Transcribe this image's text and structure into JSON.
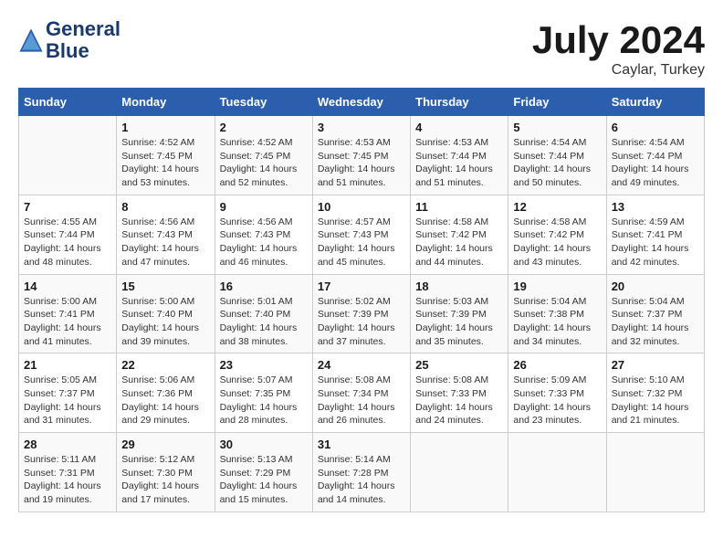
{
  "header": {
    "logo_line1": "General",
    "logo_line2": "Blue",
    "month": "July 2024",
    "location": "Caylar, Turkey"
  },
  "calendar": {
    "days_of_week": [
      "Sunday",
      "Monday",
      "Tuesday",
      "Wednesday",
      "Thursday",
      "Friday",
      "Saturday"
    ],
    "weeks": [
      [
        {
          "day": "",
          "info": ""
        },
        {
          "day": "1",
          "info": "Sunrise: 4:52 AM\nSunset: 7:45 PM\nDaylight: 14 hours\nand 53 minutes."
        },
        {
          "day": "2",
          "info": "Sunrise: 4:52 AM\nSunset: 7:45 PM\nDaylight: 14 hours\nand 52 minutes."
        },
        {
          "day": "3",
          "info": "Sunrise: 4:53 AM\nSunset: 7:45 PM\nDaylight: 14 hours\nand 51 minutes."
        },
        {
          "day": "4",
          "info": "Sunrise: 4:53 AM\nSunset: 7:44 PM\nDaylight: 14 hours\nand 51 minutes."
        },
        {
          "day": "5",
          "info": "Sunrise: 4:54 AM\nSunset: 7:44 PM\nDaylight: 14 hours\nand 50 minutes."
        },
        {
          "day": "6",
          "info": "Sunrise: 4:54 AM\nSunset: 7:44 PM\nDaylight: 14 hours\nand 49 minutes."
        }
      ],
      [
        {
          "day": "7",
          "info": "Sunrise: 4:55 AM\nSunset: 7:44 PM\nDaylight: 14 hours\nand 48 minutes."
        },
        {
          "day": "8",
          "info": "Sunrise: 4:56 AM\nSunset: 7:43 PM\nDaylight: 14 hours\nand 47 minutes."
        },
        {
          "day": "9",
          "info": "Sunrise: 4:56 AM\nSunset: 7:43 PM\nDaylight: 14 hours\nand 46 minutes."
        },
        {
          "day": "10",
          "info": "Sunrise: 4:57 AM\nSunset: 7:43 PM\nDaylight: 14 hours\nand 45 minutes."
        },
        {
          "day": "11",
          "info": "Sunrise: 4:58 AM\nSunset: 7:42 PM\nDaylight: 14 hours\nand 44 minutes."
        },
        {
          "day": "12",
          "info": "Sunrise: 4:58 AM\nSunset: 7:42 PM\nDaylight: 14 hours\nand 43 minutes."
        },
        {
          "day": "13",
          "info": "Sunrise: 4:59 AM\nSunset: 7:41 PM\nDaylight: 14 hours\nand 42 minutes."
        }
      ],
      [
        {
          "day": "14",
          "info": "Sunrise: 5:00 AM\nSunset: 7:41 PM\nDaylight: 14 hours\nand 41 minutes."
        },
        {
          "day": "15",
          "info": "Sunrise: 5:00 AM\nSunset: 7:40 PM\nDaylight: 14 hours\nand 39 minutes."
        },
        {
          "day": "16",
          "info": "Sunrise: 5:01 AM\nSunset: 7:40 PM\nDaylight: 14 hours\nand 38 minutes."
        },
        {
          "day": "17",
          "info": "Sunrise: 5:02 AM\nSunset: 7:39 PM\nDaylight: 14 hours\nand 37 minutes."
        },
        {
          "day": "18",
          "info": "Sunrise: 5:03 AM\nSunset: 7:39 PM\nDaylight: 14 hours\nand 35 minutes."
        },
        {
          "day": "19",
          "info": "Sunrise: 5:04 AM\nSunset: 7:38 PM\nDaylight: 14 hours\nand 34 minutes."
        },
        {
          "day": "20",
          "info": "Sunrise: 5:04 AM\nSunset: 7:37 PM\nDaylight: 14 hours\nand 32 minutes."
        }
      ],
      [
        {
          "day": "21",
          "info": "Sunrise: 5:05 AM\nSunset: 7:37 PM\nDaylight: 14 hours\nand 31 minutes."
        },
        {
          "day": "22",
          "info": "Sunrise: 5:06 AM\nSunset: 7:36 PM\nDaylight: 14 hours\nand 29 minutes."
        },
        {
          "day": "23",
          "info": "Sunrise: 5:07 AM\nSunset: 7:35 PM\nDaylight: 14 hours\nand 28 minutes."
        },
        {
          "day": "24",
          "info": "Sunrise: 5:08 AM\nSunset: 7:34 PM\nDaylight: 14 hours\nand 26 minutes."
        },
        {
          "day": "25",
          "info": "Sunrise: 5:08 AM\nSunset: 7:33 PM\nDaylight: 14 hours\nand 24 minutes."
        },
        {
          "day": "26",
          "info": "Sunrise: 5:09 AM\nSunset: 7:33 PM\nDaylight: 14 hours\nand 23 minutes."
        },
        {
          "day": "27",
          "info": "Sunrise: 5:10 AM\nSunset: 7:32 PM\nDaylight: 14 hours\nand 21 minutes."
        }
      ],
      [
        {
          "day": "28",
          "info": "Sunrise: 5:11 AM\nSunset: 7:31 PM\nDaylight: 14 hours\nand 19 minutes."
        },
        {
          "day": "29",
          "info": "Sunrise: 5:12 AM\nSunset: 7:30 PM\nDaylight: 14 hours\nand 17 minutes."
        },
        {
          "day": "30",
          "info": "Sunrise: 5:13 AM\nSunset: 7:29 PM\nDaylight: 14 hours\nand 15 minutes."
        },
        {
          "day": "31",
          "info": "Sunrise: 5:14 AM\nSunset: 7:28 PM\nDaylight: 14 hours\nand 14 minutes."
        },
        {
          "day": "",
          "info": ""
        },
        {
          "day": "",
          "info": ""
        },
        {
          "day": "",
          "info": ""
        }
      ]
    ]
  }
}
